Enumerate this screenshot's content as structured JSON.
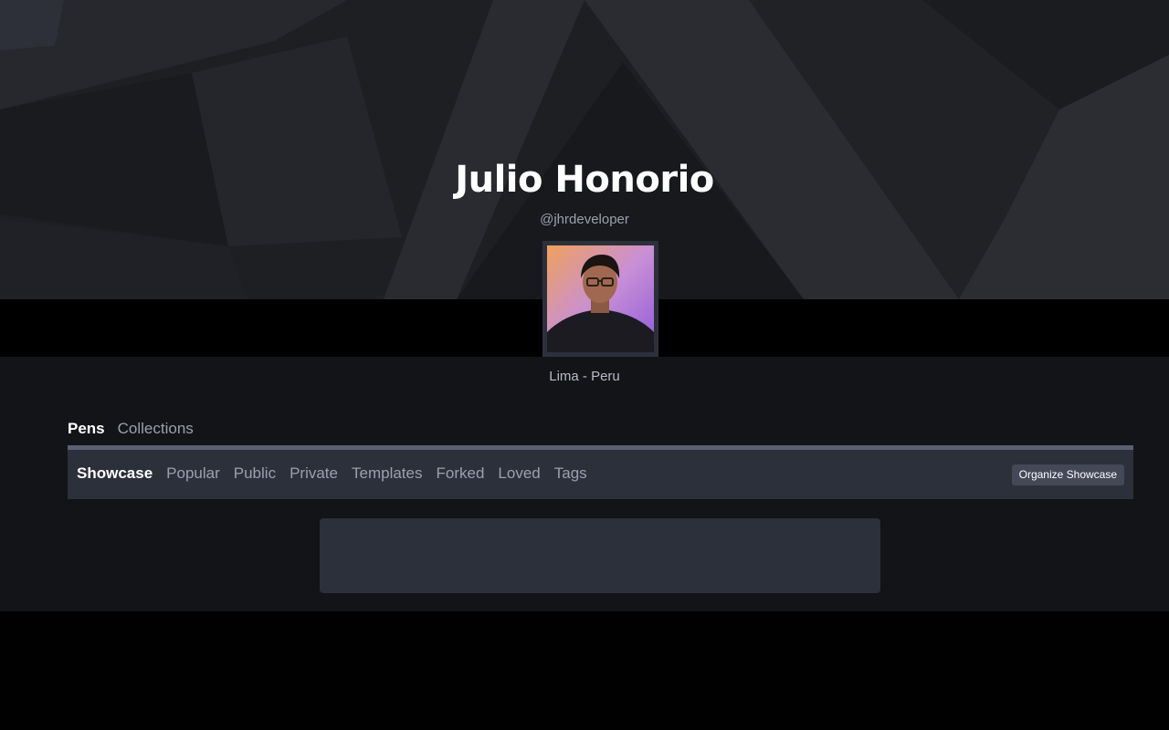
{
  "profile": {
    "name": "Julio Honorio",
    "handle": "@jhrdeveloper",
    "location": "Lima - Peru"
  },
  "top_tabs": [
    {
      "label": "Pens",
      "active": true
    },
    {
      "label": "Collections",
      "active": false
    }
  ],
  "sub_tabs": [
    {
      "label": "Showcase",
      "active": true
    },
    {
      "label": "Popular",
      "active": false
    },
    {
      "label": "Public",
      "active": false
    },
    {
      "label": "Private",
      "active": false
    },
    {
      "label": "Templates",
      "active": false
    },
    {
      "label": "Forked",
      "active": false
    },
    {
      "label": "Loved",
      "active": false
    },
    {
      "label": "Tags",
      "active": false
    }
  ],
  "actions": {
    "organize_label": "Organize Showcase"
  },
  "colors": {
    "hero_bg": "#1f2024",
    "page_bg": "#131417",
    "panel_bg": "#2c303a",
    "button_bg": "#444857"
  }
}
